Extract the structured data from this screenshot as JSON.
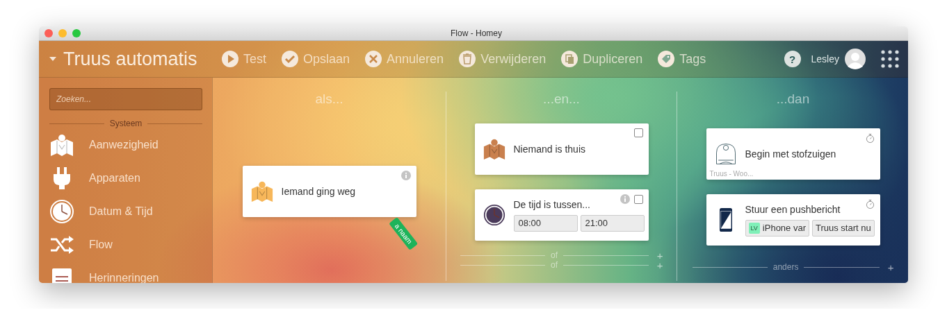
{
  "window": {
    "title": "Flow - Homey"
  },
  "toolbar": {
    "flow_name": "Truus automatis",
    "actions": [
      {
        "label": "Test",
        "kind": "play"
      },
      {
        "label": "Opslaan",
        "kind": "check"
      },
      {
        "label": "Annuleren",
        "kind": "close"
      },
      {
        "label": "Verwijderen",
        "kind": "trash"
      },
      {
        "label": "Dupliceren",
        "kind": "copy"
      },
      {
        "label": "Tags",
        "kind": "tag"
      }
    ],
    "help": "?",
    "user": {
      "name": "Lesley"
    }
  },
  "sidebar": {
    "search": {
      "placeholder": "Zoeken..."
    },
    "section": "Systeem",
    "items": [
      {
        "label": "Aanwezigheid",
        "kind": "map"
      },
      {
        "label": "Apparaten",
        "kind": "plug"
      },
      {
        "label": "Datum & Tijd",
        "kind": "clock"
      },
      {
        "label": "Flow",
        "kind": "shuffle"
      },
      {
        "label": "Herinneringen",
        "kind": "note"
      }
    ]
  },
  "columns": [
    {
      "heading": "als...",
      "cards": [
        {
          "title": "Iemand ging weg",
          "kind": "map",
          "info": true,
          "tag": "a naam"
        }
      ]
    },
    {
      "heading": "...en...",
      "cards": [
        {
          "title": "Niemand is thuis",
          "kind": "map",
          "checked": false
        },
        {
          "title": "De tijd is tussen...",
          "kind": "clock",
          "info": true,
          "checked": false,
          "fields": [
            "08:00",
            "21:00"
          ]
        }
      ],
      "footers": [
        {
          "label": "of",
          "add": "+"
        },
        {
          "label": "of",
          "add": "+"
        }
      ]
    },
    {
      "heading": "...dan",
      "cards": [
        {
          "title": "Begin met stofzuigen",
          "kind": "vacuum",
          "timer": true,
          "subtitle": "Truus - Woo..."
        },
        {
          "title": "Stuur een pushbericht",
          "kind": "phone",
          "timer": true,
          "tokens": [
            {
              "badge": "LV",
              "label": "iPhone var"
            },
            {
              "label": "Truus start nu"
            }
          ]
        }
      ],
      "footers": [
        {
          "label": "anders",
          "add": "+"
        }
      ]
    }
  ]
}
